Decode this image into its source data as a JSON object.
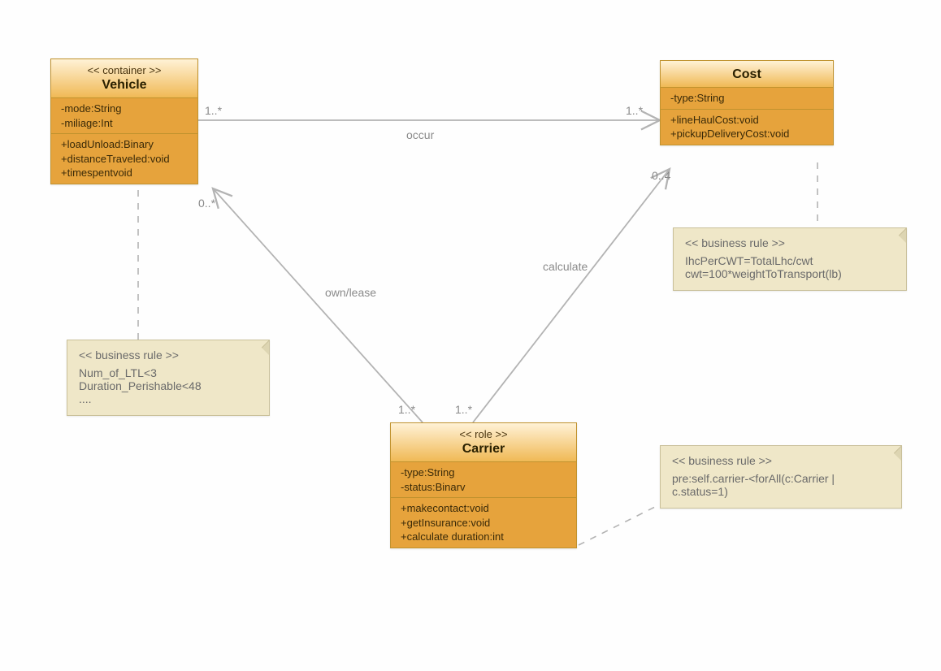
{
  "classes": {
    "vehicle": {
      "stereo": "<< container >>",
      "name": "Vehicle",
      "attributes": [
        "-mode:String",
        "-miliage:Int"
      ],
      "operations": [
        "+loadUnload:Binary",
        "+distanceTraveled:void",
        "+timespentvoid"
      ]
    },
    "cost": {
      "stereo": "",
      "name": "Cost",
      "attributes": [
        "-type:String"
      ],
      "operations": [
        "+lineHaulCost:void",
        "+pickupDeliveryCost:void"
      ]
    },
    "carrier": {
      "stereo": "<< role >>",
      "name": "Carrier",
      "attributes": [
        "-type:String",
        "-status:Binarv"
      ],
      "operations": [
        "+makecontact:void",
        "+getInsurance:void",
        "+calculate duration:int"
      ]
    }
  },
  "notes": {
    "vehicleRule": {
      "stereo": "<< business rule >>",
      "lines": [
        "Num_of_LTL<3",
        "Duration_Perishable<48",
        "...."
      ]
    },
    "costRule": {
      "stereo": "<< business rule >>",
      "lines": [
        "IhcPerCWT=TotalLhc/cwt",
        "cwt=100*weightToTransport(lb)"
      ]
    },
    "carrierRule": {
      "stereo": "<< business rule >>",
      "lines": [
        "pre:self.carrier-<forAll(c:Carrier |",
        "c.status=1)"
      ]
    }
  },
  "edges": {
    "occur": {
      "label": "occur",
      "left_mult": "1..*",
      "right_mult": "1..*"
    },
    "ownlease": {
      "label": "own/lease",
      "top_mult": "0..*",
      "bottom_mult": "1..*"
    },
    "calculate": {
      "label": "calculate",
      "top_mult": "0..4",
      "bottom_mult": "1..*"
    }
  }
}
